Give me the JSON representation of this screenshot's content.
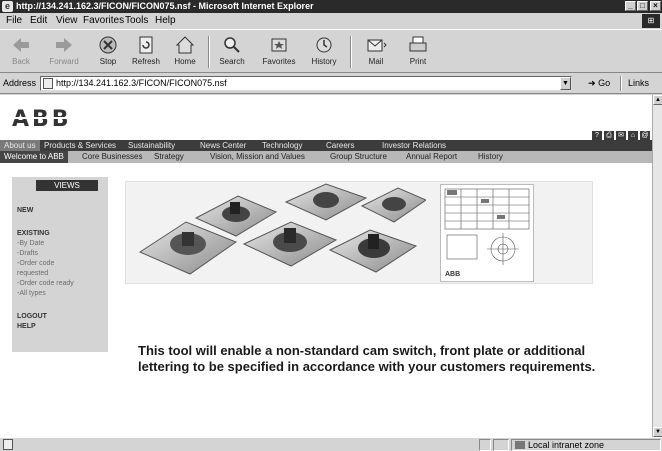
{
  "window": {
    "title": "http://134.241.162.3/FICON/FICON075.nsf - Microsoft Internet Explorer"
  },
  "menu": [
    "File",
    "Edit",
    "View",
    "Favorites",
    "Tools",
    "Help"
  ],
  "toolbar": [
    {
      "label": "Back",
      "icon": "back-arrow-icon",
      "enabled": false
    },
    {
      "label": "Forward",
      "icon": "forward-arrow-icon",
      "enabled": false
    },
    {
      "label": "Stop",
      "icon": "stop-icon",
      "enabled": true
    },
    {
      "label": "Refresh",
      "icon": "refresh-icon",
      "enabled": true
    },
    {
      "label": "Home",
      "icon": "home-icon",
      "enabled": true
    },
    {
      "label": "Search",
      "icon": "search-icon",
      "enabled": true
    },
    {
      "label": "Favorites",
      "icon": "favorites-icon",
      "enabled": true
    },
    {
      "label": "History",
      "icon": "history-icon",
      "enabled": true
    },
    {
      "label": "Mail",
      "icon": "mail-icon",
      "enabled": true
    },
    {
      "label": "Print",
      "icon": "print-icon",
      "enabled": true
    }
  ],
  "address": {
    "label": "Address",
    "url": "http://134.241.162.3/FICON/FICON075.nsf",
    "go_label": "Go",
    "links_label": "Links"
  },
  "site": {
    "logo": "ABB",
    "nav_primary": [
      "About us",
      "Products & Services",
      "Sustainability",
      "News Center",
      "Technology",
      "Careers",
      "Investor Relations"
    ],
    "nav_secondary": [
      "Welcome to ABB",
      "Core Businesses",
      "Strategy",
      "Vision, Mission and Values",
      "Group Structure",
      "Annual Report",
      "History"
    ],
    "sidebar": {
      "views_label": "VIEWS",
      "items": [
        {
          "label": "NEW",
          "kind": "heading"
        },
        {
          "label": "EXISTING",
          "kind": "heading"
        },
        {
          "label": "-By Date",
          "kind": "sub"
        },
        {
          "label": "-Drafts",
          "kind": "sub"
        },
        {
          "label": "-Order code",
          "kind": "sub"
        },
        {
          "label": "requested",
          "kind": "sub"
        },
        {
          "label": "-Order code ready",
          "kind": "sub"
        },
        {
          "label": "-All types",
          "kind": "sub"
        },
        {
          "label": "LOGOUT",
          "kind": "heading"
        },
        {
          "label": "HELP",
          "kind": "heading"
        }
      ]
    },
    "datasheet_logo": "ABB",
    "message": "This tool will enable a non-standard cam switch, front plate or additional lettering to be specified in accordance with your customers requirements."
  },
  "status": {
    "zone_label": "Local intranet zone"
  }
}
